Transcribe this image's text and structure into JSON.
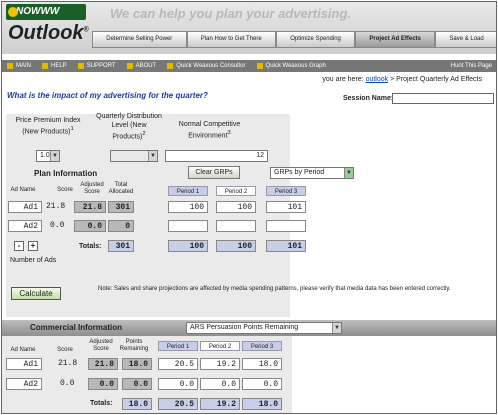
{
  "header": {
    "logo_text": "NOWWW",
    "tagline": "We can help you plan your advertising.",
    "brand": "Outlook",
    "brand_mark": "®",
    "tabs": [
      "Determine Selling Power",
      "Plan How to Get There",
      "Optimize Spending",
      "Project Ad Effects",
      "Save & Load"
    ],
    "active_tab": "Project Ad Effects"
  },
  "nav": {
    "items": [
      "MAIN",
      "HELP",
      "SUPPORT",
      "ABOUT",
      "Quick Weaxous Consultor",
      "Quick Weaxous Graph"
    ],
    "right_item": "Hunt This Page"
  },
  "breadcrumb": {
    "prefix": "you are here:",
    "link": "outlook",
    "separator": ">",
    "current": "Project Quarterly Ad Effects"
  },
  "question": "What is the impact of my advertising for the quarter?",
  "session": {
    "label": "Session Name:",
    "value": ""
  },
  "inputs": {
    "price_label": "Price Premium Index (New Products)",
    "price_note": "1",
    "price_value": "1.0",
    "dist_label": "Quarterly Distribution Level (New Products)",
    "dist_note": "2",
    "dist_value": "",
    "env_label": "Normal Competitive Environment",
    "env_note": "3",
    "env_value": "12"
  },
  "plan": {
    "title": "Plan Information",
    "clear_button": "Clear GRPs",
    "view_select": "GRPs by Period",
    "col_ad_name": "Ad Name",
    "col_score": "Score",
    "col_adjusted": "Adjusted Score",
    "col_total": "Total Allocated",
    "periods": [
      "Period 1",
      "Period 2",
      "Period 3"
    ],
    "rows": [
      {
        "name": "Ad1",
        "score": "21.8",
        "adjusted": "21.8",
        "total": "301",
        "p1": "100",
        "p2": "100",
        "p3": "101"
      },
      {
        "name": "Ad2",
        "score": "0.0",
        "adjusted": "0.0",
        "total": "0",
        "p1": "",
        "p2": "",
        "p3": ""
      }
    ],
    "totals_label": "Totals:",
    "totals": {
      "total": "301",
      "p1": "100",
      "p2": "100",
      "p3": "101"
    },
    "minus_label": "-",
    "plus_label": "+",
    "num_ads_label": "Number of Ads"
  },
  "calculate_button": "Calculate",
  "note": "Note: Sales and share projections are affected by media spending patterns, please verify that media data has been entered correctly.",
  "commercial": {
    "title": "Commercial Information",
    "select": "ARS Persuasion Points Remaining",
    "col_ad_name": "Ad Name",
    "col_score": "Score",
    "col_adjusted": "Adjusted Score",
    "col_points": "Points Remaining",
    "periods": [
      "Period 1",
      "Period 2",
      "Period 3"
    ],
    "rows": [
      {
        "name": "Ad1",
        "score": "21.8",
        "adjusted": "21.8",
        "points": "18.0",
        "p1": "20.5",
        "p2": "19.2",
        "p3": "18.0"
      },
      {
        "name": "Ad2",
        "score": "0.0",
        "adjusted": "0.0",
        "points": "0.0",
        "p1": "0.0",
        "p2": "0.0",
        "p3": "0.0"
      }
    ],
    "totals_label": "Totals:",
    "totals": {
      "points": "18.0",
      "p1": "20.5",
      "p2": "19.2",
      "p3": "18.0"
    }
  }
}
